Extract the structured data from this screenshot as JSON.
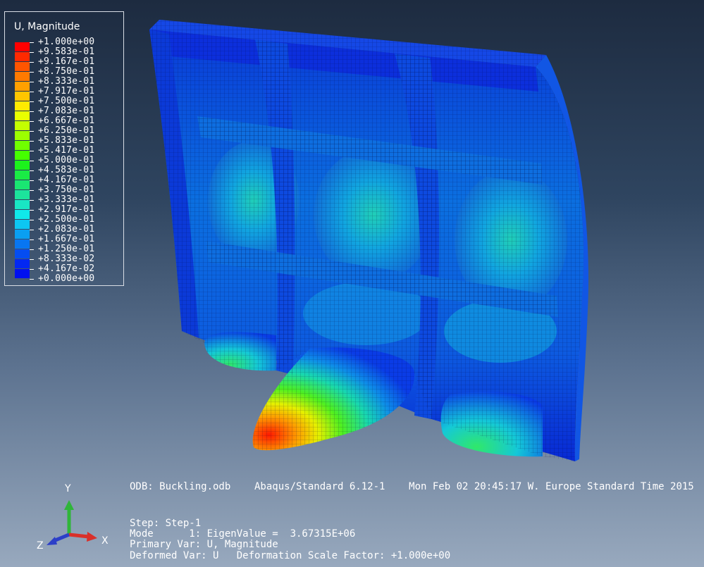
{
  "legend": {
    "title": "U, Magnitude",
    "entries": [
      {
        "label": "+1.000e+00",
        "color": "#ff0000"
      },
      {
        "label": "+9.583e-01",
        "color": "#ff2a00"
      },
      {
        "label": "+9.167e-01",
        "color": "#ff5500"
      },
      {
        "label": "+8.750e-01",
        "color": "#ff7a00"
      },
      {
        "label": "+8.333e-01",
        "color": "#ffa000"
      },
      {
        "label": "+7.917e-01",
        "color": "#ffc600"
      },
      {
        "label": "+7.500e-01",
        "color": "#ffea00"
      },
      {
        "label": "+7.083e-01",
        "color": "#e9ff00"
      },
      {
        "label": "+6.667e-01",
        "color": "#c4ff00"
      },
      {
        "label": "+6.250e-01",
        "color": "#9cff00"
      },
      {
        "label": "+5.833e-01",
        "color": "#70ff00"
      },
      {
        "label": "+5.417e-01",
        "color": "#45ff00"
      },
      {
        "label": "+5.000e-01",
        "color": "#1cf21c"
      },
      {
        "label": "+4.583e-01",
        "color": "#1aeb45"
      },
      {
        "label": "+4.167e-01",
        "color": "#1ae672"
      },
      {
        "label": "+3.750e-01",
        "color": "#1ce39c"
      },
      {
        "label": "+3.333e-01",
        "color": "#19e6c4"
      },
      {
        "label": "+2.917e-01",
        "color": "#10e8ea"
      },
      {
        "label": "+2.500e-01",
        "color": "#0dc6f2"
      },
      {
        "label": "+2.083e-01",
        "color": "#0a9ff2"
      },
      {
        "label": "+1.667e-01",
        "color": "#0876f2"
      },
      {
        "label": "+1.250e-01",
        "color": "#054df2"
      },
      {
        "label": "+8.333e-02",
        "color": "#0328f2"
      },
      {
        "label": "+4.167e-02",
        "color": "#0010f0"
      },
      {
        "label": "+0.000e+00",
        "color": null
      }
    ]
  },
  "info": {
    "odb_line": "ODB: Buckling.odb    Abaqus/Standard 6.12-1    Mon Feb 02 20:45:17 W. Europe Standard Time 2015",
    "step_line": "Step: Step-1",
    "mode_line": "Mode      1: EigenValue =  3.67315E+06",
    "primary_line": "Primary Var: U, Magnitude",
    "deformed_line": "Deformed Var: U   Deformation Scale Factor: +1.000e+00"
  },
  "triad": {
    "y_label": "Y",
    "z_label": "Z",
    "x_label": "X",
    "y_color": "#2fb53a",
    "x_color": "#d9302a",
    "z_color": "#2c3fc8"
  }
}
